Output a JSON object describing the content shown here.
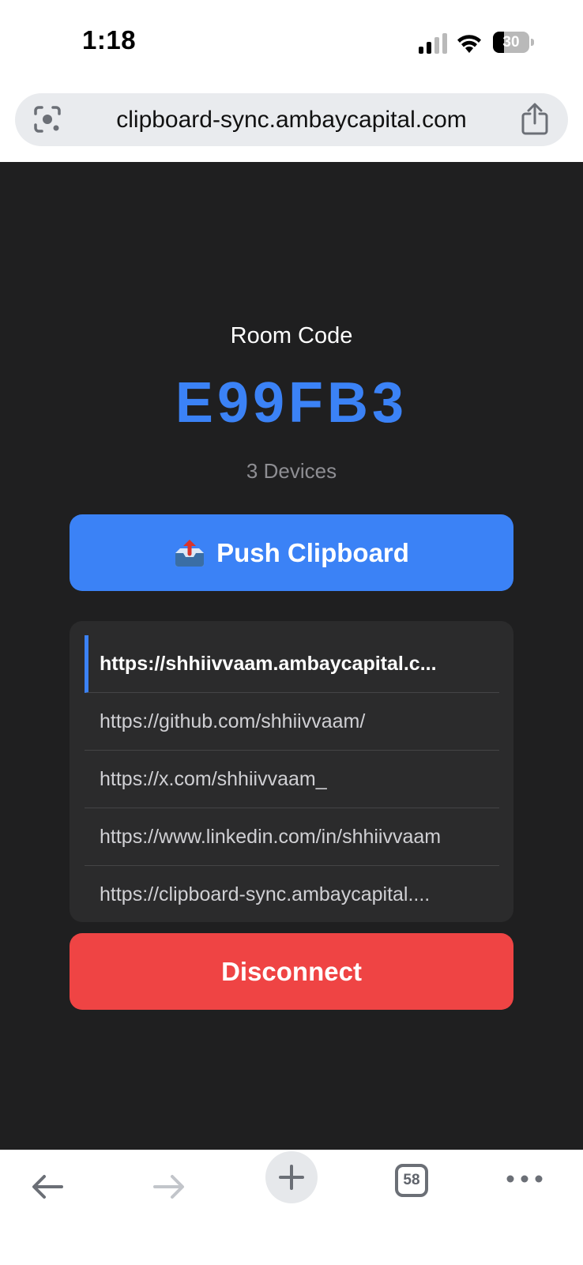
{
  "status_bar": {
    "time": "1:18",
    "battery_level": "30",
    "battery_fraction": 0.3,
    "icons": [
      "cellular-signal-icon",
      "wifi-icon",
      "battery-icon"
    ]
  },
  "browser": {
    "url": "clipboard-sync.ambaycapital.com",
    "icons": [
      "lens-icon",
      "share-icon"
    ]
  },
  "page": {
    "room_label": "Room Code",
    "room_code": "E99FB3",
    "device_count": "3 Devices",
    "push_button": {
      "icon": "📤",
      "label": "Push Clipboard"
    },
    "history": [
      "https://shhiivvaam.ambaycapital.c...",
      "https://github.com/shhiivvaam/",
      "https://x.com/shhiivvaam_",
      "https://www.linkedin.com/in/shhiivvaam",
      "https://clipboard-sync.ambaycapital...."
    ],
    "disconnect_label": "Disconnect"
  },
  "toolbar": {
    "tab_count": "58",
    "icons": [
      "back-arrow-icon",
      "forward-arrow-icon",
      "new-tab-plus-icon",
      "tabs-icon",
      "more-icon"
    ]
  },
  "colors": {
    "accent": "#3b82f6",
    "danger": "#ef4444",
    "background": "#1f1f20",
    "card": "#2b2b2c"
  }
}
